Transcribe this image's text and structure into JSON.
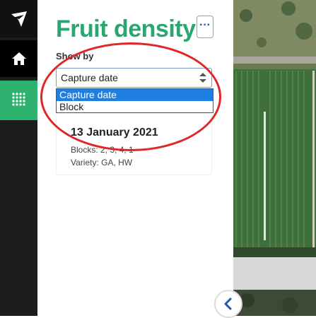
{
  "panel": {
    "title": "Fruit density",
    "more_label": "···",
    "show_by_label": "Show by",
    "select_value": "Capture date",
    "options": [
      "Capture date",
      "Block"
    ],
    "card": {
      "date": "13 January 2021",
      "blocks": "Blocks: 2, 3, 4, 1",
      "variety": "Variety: GA, HW"
    }
  },
  "colors": {
    "accent": "#2aa673",
    "rail": "#1c1c1c",
    "active_rail": "#2db26f",
    "highlight": "#1e7fe0",
    "annotation": "#e02626"
  },
  "icons": [
    "logo-icon",
    "home-icon",
    "grid-dots-icon",
    "select-arrows-icon",
    "chevron-left-icon"
  ]
}
